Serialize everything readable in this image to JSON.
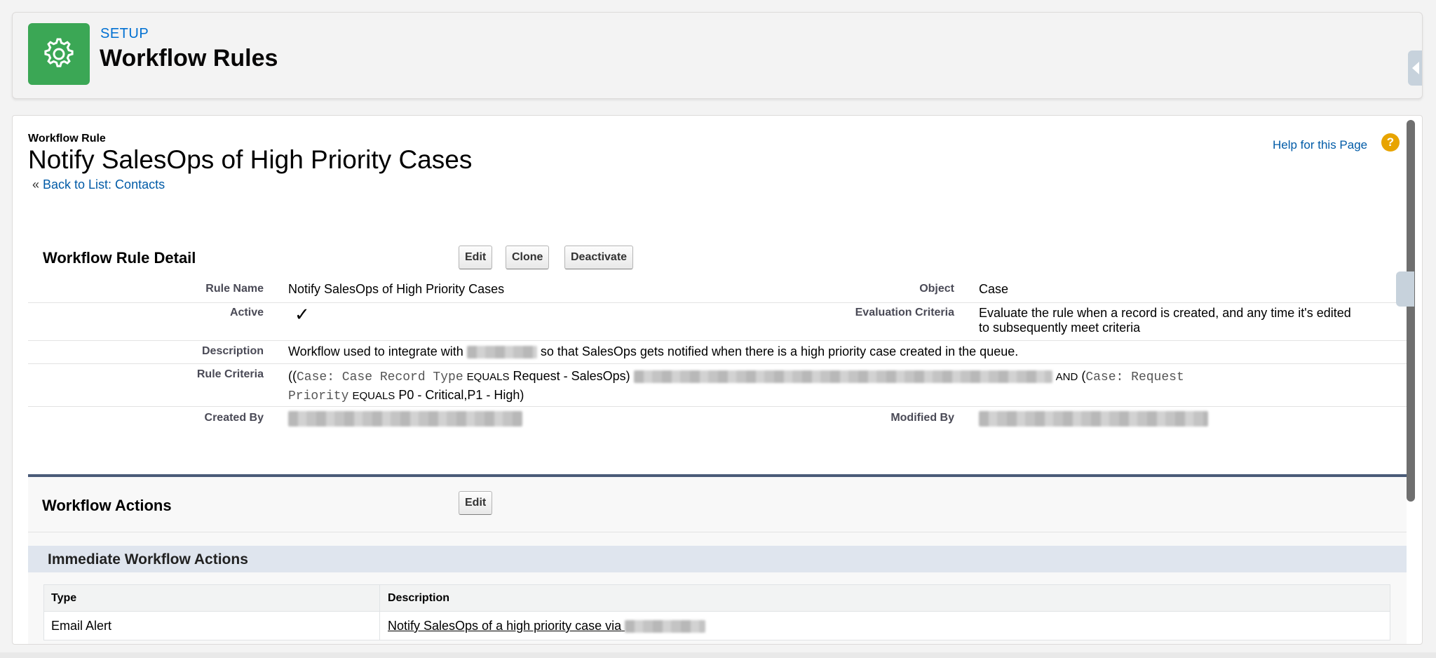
{
  "header": {
    "section_label": "SETUP",
    "title": "Workflow Rules",
    "icon": "gear-icon",
    "icon_color": "#3ba755"
  },
  "page": {
    "object_label": "Workflow Rule",
    "title": "Notify SalesOps of High Priority Cases",
    "back_prefix": "« ",
    "back_link": "Back to List: Contacts",
    "help_link": "Help for this Page",
    "help_icon_glyph": "?"
  },
  "detail": {
    "title": "Workflow Rule Detail",
    "buttons": {
      "edit": "Edit",
      "clone": "Clone",
      "deactivate": "Deactivate"
    },
    "fields": {
      "rule_name_label": "Rule Name",
      "rule_name_value": "Notify SalesOps of High Priority Cases",
      "object_label": "Object",
      "object_value": "Case",
      "active_label": "Active",
      "active_value": "✓",
      "eval_label": "Evaluation Criteria",
      "eval_line1": "Evaluate the rule when a record is created, and any time it's edited",
      "eval_line2": "to subsequently meet criteria",
      "description_label": "Description",
      "description_prefix": "Workflow used to integrate with",
      "description_suffix": "so that SalesOps gets notified when there is a high priority case created in the queue.",
      "criteria_label": "Rule Criteria",
      "criteria_open": "((",
      "criteria_field1": "Case: Case Record Type",
      "criteria_op1": "EQUALS",
      "criteria_val1": "Request - SalesOps)",
      "criteria_and": "AND",
      "criteria_paren": "(",
      "criteria_field2a": "Case: Request",
      "criteria_field2b": "Priority",
      "criteria_op2": "EQUALS",
      "criteria_val2": "P0 - Critical,P1 - High)",
      "created_label": "Created By",
      "modified_label": "Modified By"
    }
  },
  "actions": {
    "title": "Workflow Actions",
    "edit_button": "Edit",
    "immediate_title": "Immediate Workflow Actions",
    "columns": [
      "Type",
      "Description"
    ],
    "rows": [
      {
        "type": "Email Alert",
        "description_prefix": "Notify SalesOps of a high priority case via"
      }
    ]
  }
}
